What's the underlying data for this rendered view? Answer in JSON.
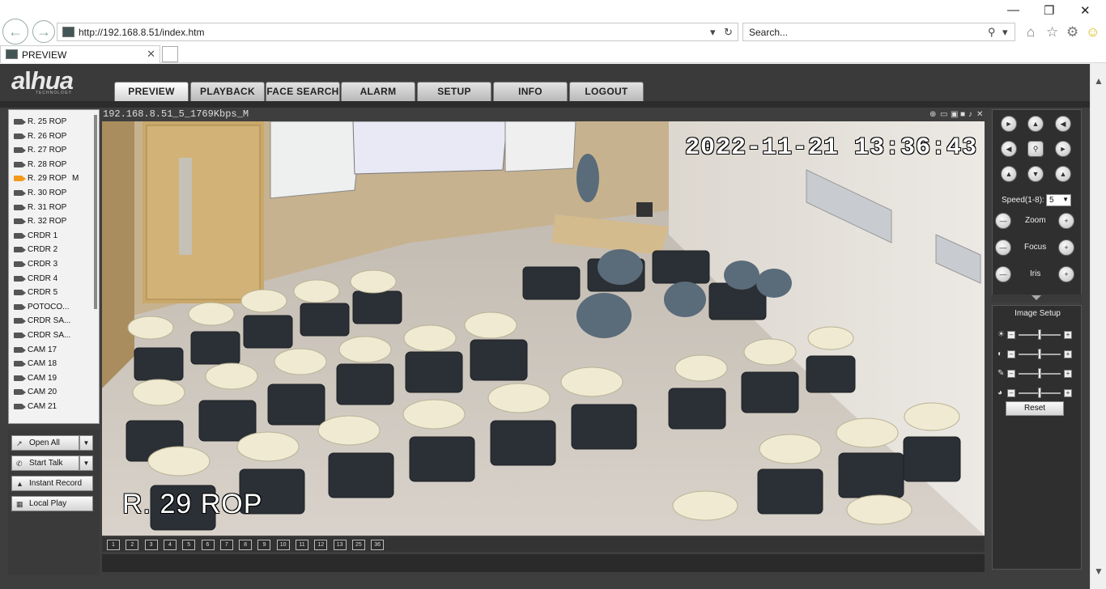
{
  "browser": {
    "url": "http://192.168.8.51/index.htm",
    "search_placeholder": "Search...",
    "tab_title": "PREVIEW"
  },
  "nav": {
    "tabs": [
      "PREVIEW",
      "PLAYBACK",
      "FACE SEARCH",
      "ALARM",
      "SETUP",
      "INFO",
      "LOGOUT"
    ],
    "active": "PREVIEW"
  },
  "cameras": [
    {
      "label": "R. 25 ROP"
    },
    {
      "label": "R. 26 ROP"
    },
    {
      "label": "R. 27 ROP"
    },
    {
      "label": "R. 28 ROP"
    },
    {
      "label": "R. 29 ROP",
      "suffix": "M",
      "active": true
    },
    {
      "label": "R. 30 ROP"
    },
    {
      "label": "R. 31 ROP"
    },
    {
      "label": "R. 32 ROP"
    },
    {
      "label": "CRDR 1"
    },
    {
      "label": "CRDR 2"
    },
    {
      "label": "CRDR 3"
    },
    {
      "label": "CRDR 4"
    },
    {
      "label": "CRDR 5"
    },
    {
      "label": "POTOCO..."
    },
    {
      "label": "CRDR SA..."
    },
    {
      "label": "CRDR SA..."
    },
    {
      "label": "CAM 17"
    },
    {
      "label": "CAM 18"
    },
    {
      "label": "CAM 19"
    },
    {
      "label": "CAM 20"
    },
    {
      "label": "CAM 21"
    }
  ],
  "controls": {
    "open_all": "Open All",
    "start_talk": "Start Talk",
    "instant_record": "Instant Record",
    "local_play": "Local Play"
  },
  "video": {
    "stream_info": "192.168.8.51_5_1769Kbps_M",
    "osd_time": "2022-11-21  13:36:43",
    "osd_name": "R. 29 ROP"
  },
  "layout_buttons": [
    "1",
    "2",
    "3",
    "4",
    "5",
    "6",
    "7",
    "8",
    "9",
    "10",
    "11",
    "12",
    "13",
    "25",
    "36"
  ],
  "ptz": {
    "speed_label": "Speed(1-8):",
    "speed_value": "5",
    "zoom_label": "Zoom",
    "focus_label": "Focus",
    "iris_label": "Iris"
  },
  "image_setup": {
    "title": "Image Setup",
    "reset_label": "Reset",
    "sliders": [
      {
        "name": "brightness",
        "icon": "sun-icon",
        "level": 0.5
      },
      {
        "name": "contrast",
        "icon": "contrast-icon",
        "level": 0.5
      },
      {
        "name": "saturation",
        "icon": "saturation-icon",
        "level": 0.5
      },
      {
        "name": "hue",
        "icon": "hue-icon",
        "level": 0.5
      }
    ]
  },
  "colors": {
    "page_bg": "#3e3e3e",
    "active_camera": "#f39a1b"
  }
}
